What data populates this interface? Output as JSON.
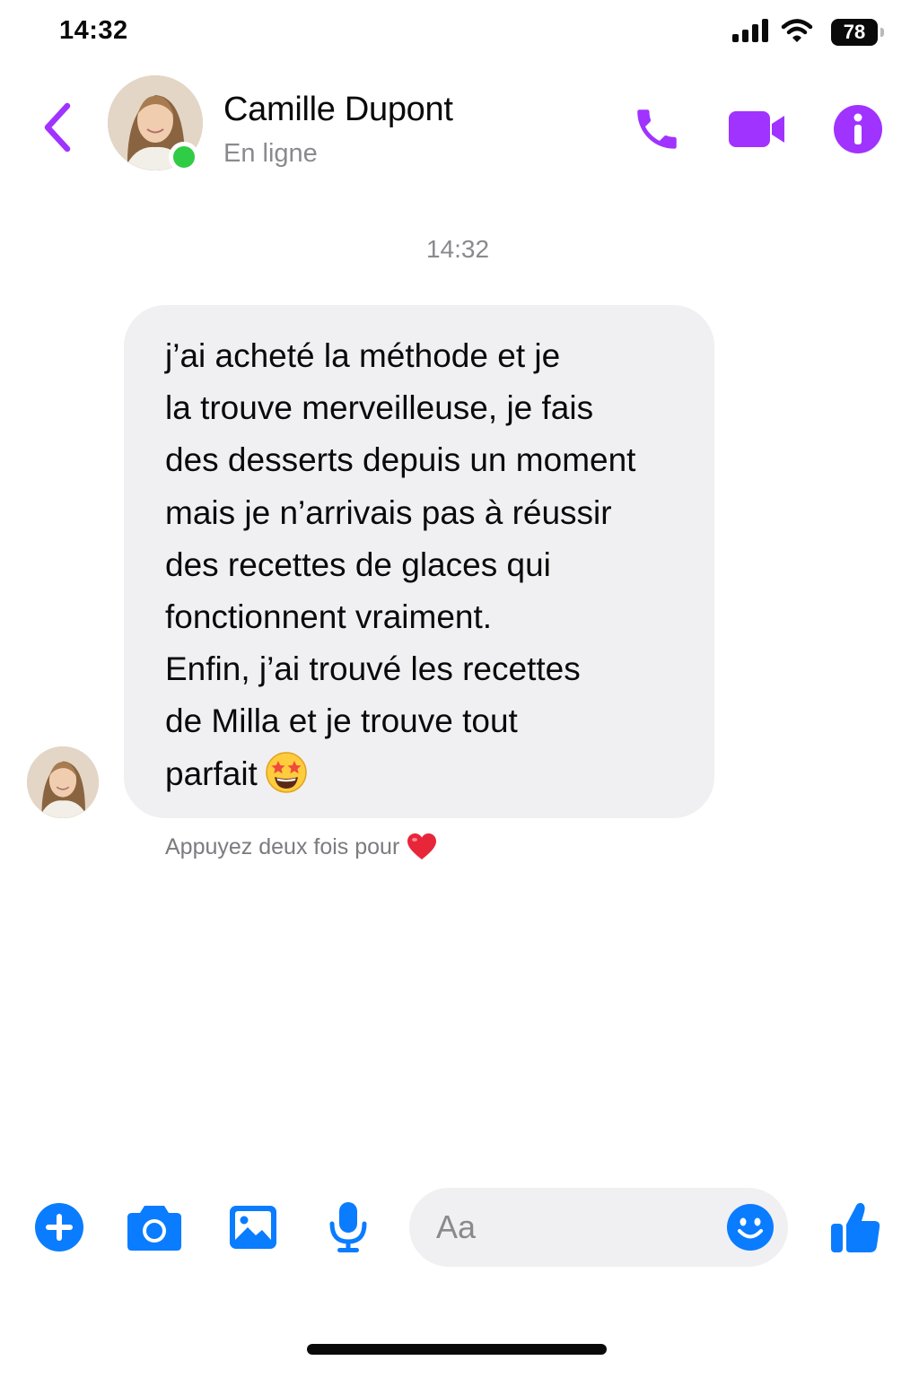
{
  "status_bar": {
    "time": "14:32",
    "battery": "78",
    "icons": [
      "cellular-signal-icon",
      "wifi-icon",
      "battery-icon"
    ]
  },
  "header": {
    "contact_name": "Camille Dupont",
    "contact_status": "En ligne",
    "actions": [
      "back-chevron-icon",
      "phone-icon",
      "video-camera-icon",
      "info-icon"
    ]
  },
  "chat": {
    "timestamp": "14:32",
    "message_lines": [
      "j’ai acheté la méthode et je",
      "la trouve merveilleuse, je fais",
      "des desserts depuis un moment",
      "mais je n’arrivais pas à réussir",
      "des recettes de glaces qui",
      "fonctionnent vraiment.",
      "Enfin, j’ai trouvé les recettes",
      "de Milla et je trouve tout",
      "parfait"
    ],
    "message_emoji": "star-struck-emoji",
    "hint": "Appuyez deux fois pour",
    "hint_emoji": "red-heart-emoji"
  },
  "composer": {
    "placeholder": "Aa",
    "actions": [
      "plus-icon",
      "camera-icon",
      "image-icon",
      "microphone-icon",
      "emoji-icon",
      "thumbs-up-icon"
    ]
  },
  "colors": {
    "header_accent": "#a033ff",
    "composer_accent": "#0a7cff",
    "bubble": "#f0f0f2",
    "online": "#31cc46"
  }
}
